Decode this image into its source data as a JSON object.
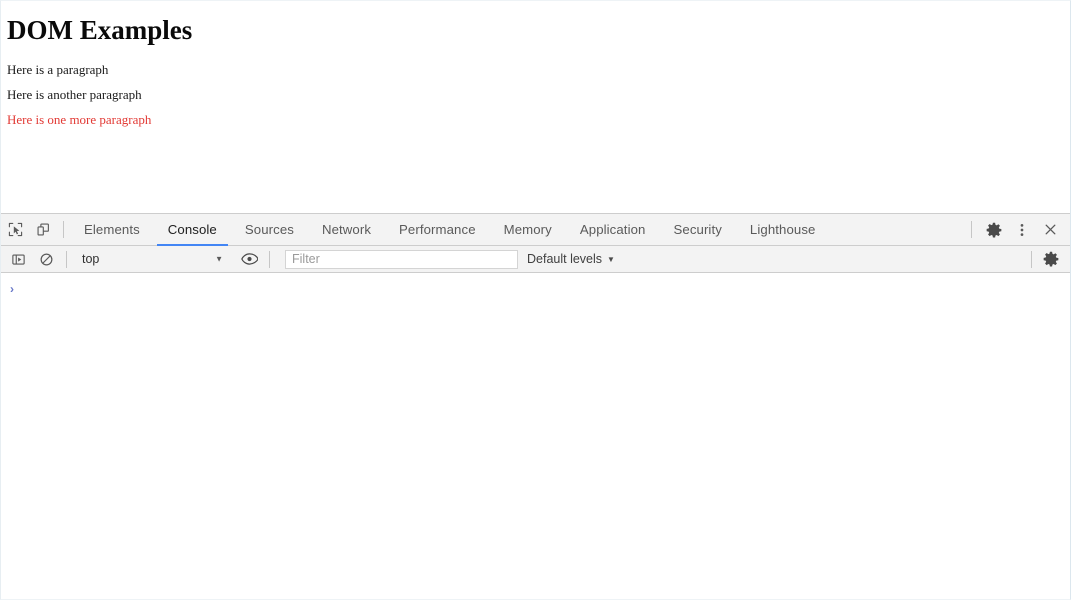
{
  "page": {
    "title": "DOM Examples",
    "paragraphs": [
      {
        "text": "Here is a paragraph",
        "color": "#1a1a1a"
      },
      {
        "text": "Here is another paragraph",
        "color": "#1a1a1a"
      },
      {
        "text": "Here is one more paragraph",
        "color": "#e23a35"
      }
    ]
  },
  "devtools": {
    "accent_color": "#4285f4",
    "toolbar_background": "#f3f3f3",
    "left_icons": [
      {
        "name": "inspect-element-icon",
        "title": "Inspect"
      },
      {
        "name": "device-toolbar-icon",
        "title": "Toggle device toolbar"
      }
    ],
    "tabs": [
      {
        "label": "Elements",
        "active": false
      },
      {
        "label": "Console",
        "active": true
      },
      {
        "label": "Sources",
        "active": false
      },
      {
        "label": "Network",
        "active": false
      },
      {
        "label": "Performance",
        "active": false
      },
      {
        "label": "Memory",
        "active": false
      },
      {
        "label": "Application",
        "active": false
      },
      {
        "label": "Security",
        "active": false
      },
      {
        "label": "Lighthouse",
        "active": false
      }
    ],
    "tabbar_right_icons": [
      {
        "name": "settings-gear-icon",
        "title": "Settings"
      },
      {
        "name": "more-options-icon",
        "title": "Customize and control DevTools"
      },
      {
        "name": "close-icon",
        "title": "Close DevTools"
      }
    ],
    "console_toolbar": {
      "sidebar_toggle": {
        "name": "console-sidebar-toggle-icon",
        "title": "Show console sidebar"
      },
      "clear_console": {
        "name": "clear-console-icon",
        "title": "Clear console"
      },
      "context_selector": {
        "value": "top",
        "caret": "▼"
      },
      "live_expression": {
        "name": "eye-icon",
        "title": "Create live expression"
      },
      "filter": {
        "value": "",
        "placeholder": "Filter"
      },
      "levels_selector": {
        "label": "Default levels",
        "caret": "▼"
      },
      "settings": {
        "name": "console-settings-gear-icon",
        "title": "Console settings"
      }
    },
    "console_output": {
      "prompt_symbol": "›",
      "prompt_color": "#6878c8",
      "messages": []
    }
  }
}
